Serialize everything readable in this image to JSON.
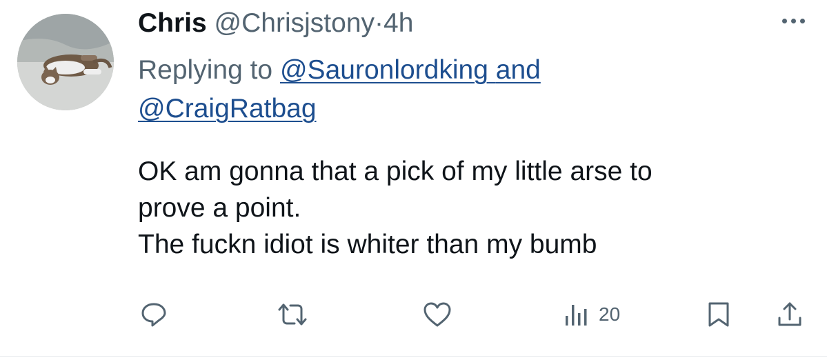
{
  "tweet": {
    "author_name": "Chris",
    "author_handle": "@Chrisjstony",
    "separator": "·",
    "time": "4h",
    "reply_prefix": "Replying to",
    "reply_user_1": "@Sauronlordking",
    "reply_conjunction": "and",
    "reply_user_2": "@CraigRatbag",
    "body_lines": [
      "OK am gonna that a pick of my little arse to",
      "prove a point.",
      "The fuckn idiot is whiter than my bumb"
    ]
  },
  "actions": {
    "views_count": "20",
    "icons": [
      "reply-icon",
      "retweet-icon",
      "like-icon",
      "views-icon",
      "bookmark-icon",
      "share-icon"
    ]
  },
  "colors": {
    "text": "#0f1419",
    "secondary": "#536471",
    "link": "#1d4e8f"
  }
}
